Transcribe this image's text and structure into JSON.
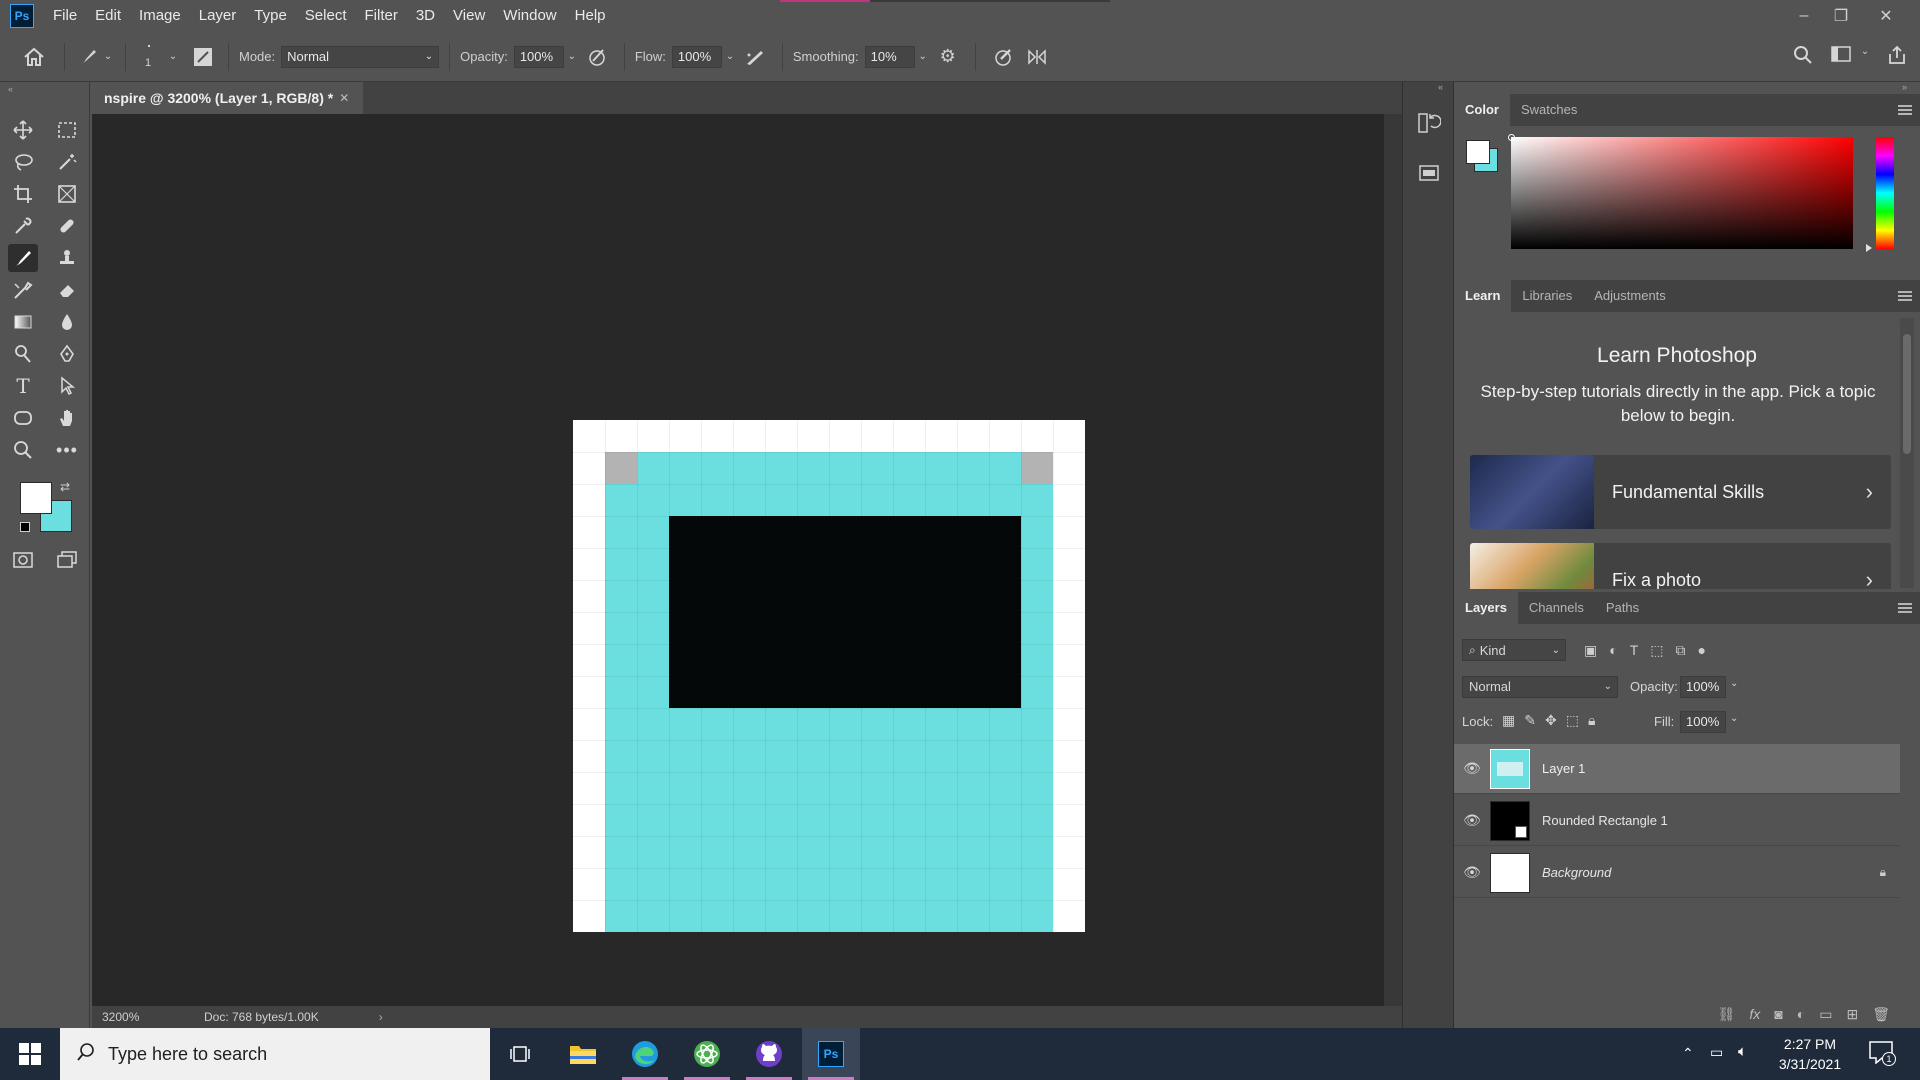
{
  "app": {
    "logo": "Ps"
  },
  "menu": [
    "File",
    "Edit",
    "Image",
    "Layer",
    "Type",
    "Select",
    "Filter",
    "3D",
    "View",
    "Window",
    "Help"
  ],
  "window_controls": {
    "minimize": "–",
    "restore": "❐",
    "close": "✕"
  },
  "options": {
    "brush_size": "1",
    "mode_label": "Mode:",
    "mode_value": "Normal",
    "opacity_label": "Opacity:",
    "opacity_value": "100%",
    "flow_label": "Flow:",
    "flow_value": "100%",
    "smoothing_label": "Smoothing:",
    "smoothing_value": "10%"
  },
  "document": {
    "tab_title": "nspire @ 3200% (Layer 1, RGB/8) *",
    "close": "✕",
    "zoom": "3200%",
    "doc_info": "Doc: 768 bytes/1.00K",
    "artwork_colors": {
      "background": "#ffffff",
      "body": "#6bdee0",
      "screen": "#050808",
      "corner": "#b3b3b3"
    }
  },
  "colors": {
    "foreground": "#ffffff",
    "background": "#6bdee0",
    "accent": "#31a8ff"
  },
  "color_panel": {
    "tabs": [
      "Color",
      "Swatches"
    ]
  },
  "learn_panel": {
    "tabs": [
      "Learn",
      "Libraries",
      "Adjustments"
    ],
    "title": "Learn Photoshop",
    "description": "Step-by-step tutorials directly in the app. Pick a topic below to begin.",
    "cards": [
      {
        "label": "Fundamental Skills"
      },
      {
        "label": "Fix a photo"
      }
    ]
  },
  "layers_panel": {
    "tabs": [
      "Layers",
      "Channels",
      "Paths"
    ],
    "filter_kind": "Kind",
    "blend_mode": "Normal",
    "opacity_label": "Opacity:",
    "opacity_value": "100%",
    "lock_label": "Lock:",
    "fill_label": "Fill:",
    "fill_value": "100%",
    "layers": [
      {
        "name": "Layer 1",
        "selected": true
      },
      {
        "name": "Rounded Rectangle 1",
        "selected": false
      },
      {
        "name": "Background",
        "selected": false,
        "locked": true
      }
    ]
  },
  "taskbar": {
    "search_placeholder": "Type here to search",
    "time": "2:27 PM",
    "date": "3/31/2021",
    "notification_count": "1"
  }
}
